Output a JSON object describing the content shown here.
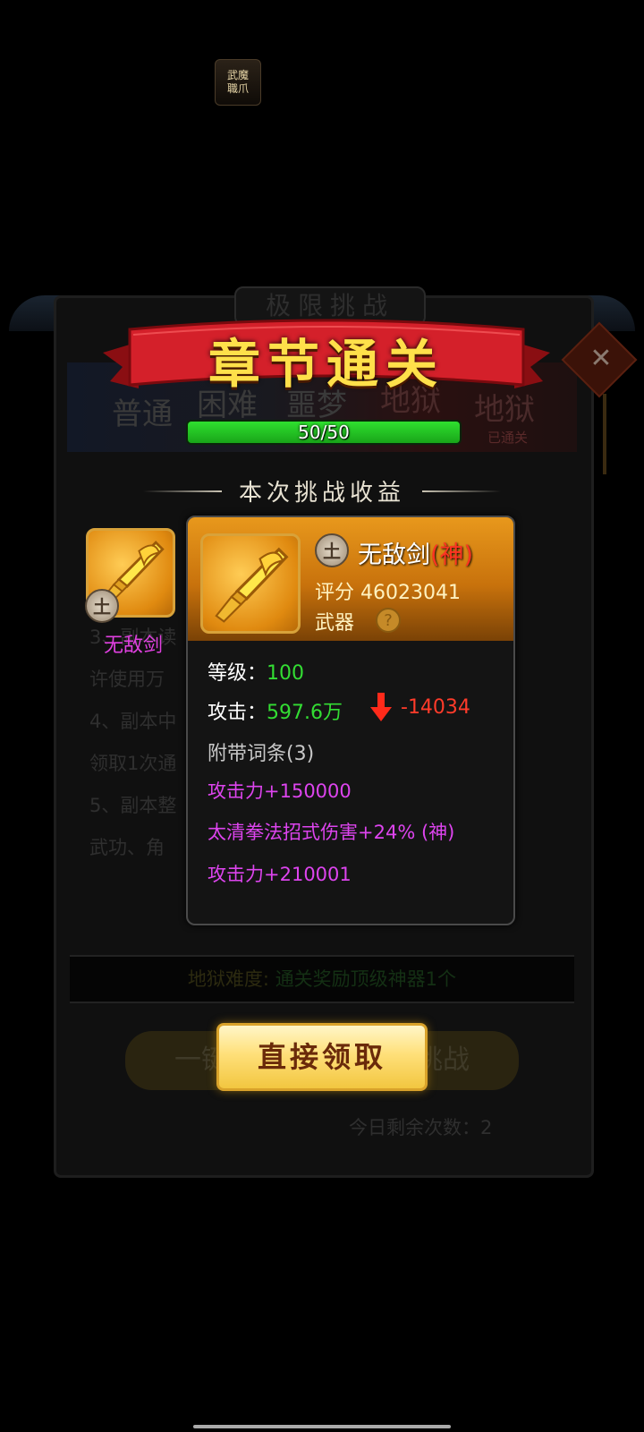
{
  "app_badge": "武\n魔\n職\n爪",
  "background": {
    "top_tab": "极限挑战",
    "stage_chars": [
      "普通",
      "困难",
      "噩梦",
      "地狱",
      "地狱"
    ],
    "stage_cleared_tag": "已通关",
    "rules": [
      "3、副本读",
      "许使用万",
      "4、副本中",
      "领取1次通",
      "5、副本整",
      "武功、角"
    ],
    "hell_label": "地狱难度:",
    "hell_value": "通关奖励顶级神器1个",
    "btn_left": "一键",
    "btn_right": "挑战",
    "remaining": "今日剩余次数：2"
  },
  "banner": {
    "title": "章节通关"
  },
  "progress": {
    "text": "50/50",
    "value": 50,
    "max": 50
  },
  "rewards": {
    "section_title": "本次挑战收益",
    "items": [
      {
        "name": "无敌剑",
        "element": "土",
        "icon": "golden-sword-icon"
      }
    ]
  },
  "tooltip": {
    "element": "土",
    "name": "无敌剑",
    "quality": "(神)",
    "score_label": "评分",
    "score": "46023041",
    "type": "武器",
    "help": "?",
    "level_label": "等级：",
    "level": "100",
    "attack_label": "攻击：",
    "attack": "597.6万",
    "attack_delta": "-14034",
    "affix_title": "附带词条(3)",
    "affixes": [
      "攻击力+150000",
      "太清拳法招式伤害+24% (神)",
      "攻击力+210001"
    ]
  },
  "claim_button": {
    "label": "直接领取"
  },
  "colors": {
    "quality_god": "#ff3322",
    "affix": "#dd44ee",
    "stat": "#33dd33",
    "decrease": "#ff3b2a"
  }
}
